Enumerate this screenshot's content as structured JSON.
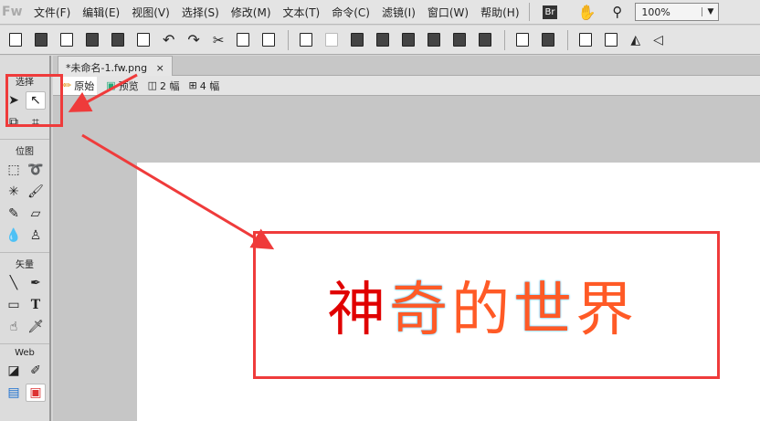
{
  "menubar": {
    "logo": "Fw",
    "items": [
      "文件(F)",
      "编辑(E)",
      "视图(V)",
      "选择(S)",
      "修改(M)",
      "文本(T)",
      "命令(C)",
      "滤镜(I)",
      "窗口(W)",
      "帮助(H)"
    ],
    "bridge": "Br",
    "zoom": "100%"
  },
  "document": {
    "tab_title": "*未命名-1.fw.png",
    "close": "×"
  },
  "views": [
    "原始",
    "预览",
    "2 幅",
    "4 幅"
  ],
  "tools": {
    "select": "选择",
    "bitmap": "位图",
    "vector": "矢量",
    "web": "Web"
  },
  "canvas": {
    "chars": [
      "神",
      "奇",
      "的",
      "世",
      "界"
    ]
  },
  "colors": {
    "annotation": "#ef3b3b",
    "text": "#ff5a26",
    "selection": "#1ab0ff"
  }
}
